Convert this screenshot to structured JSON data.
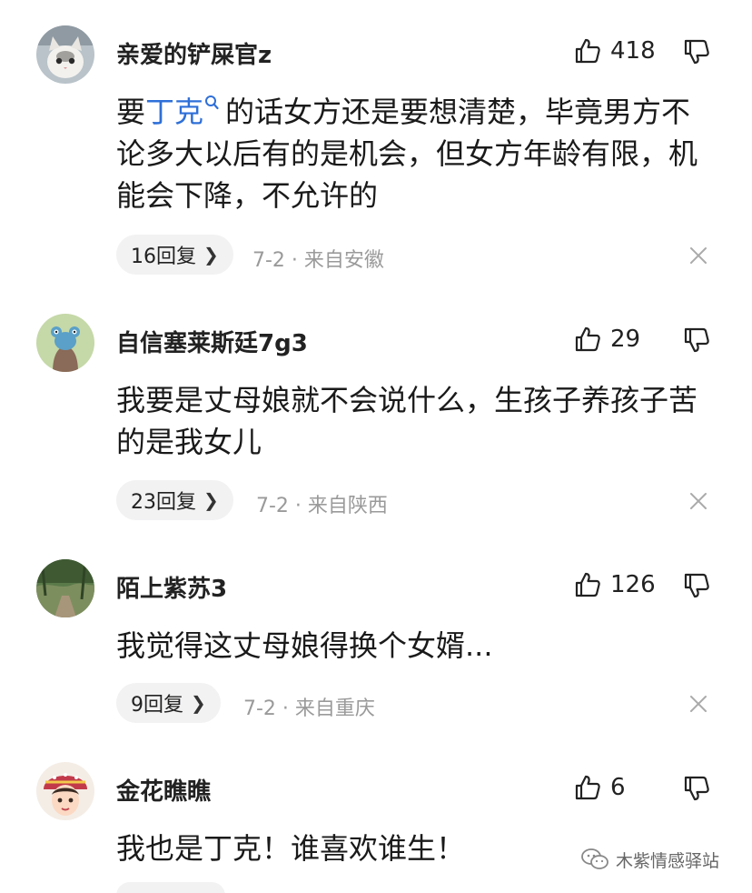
{
  "comments": [
    {
      "username": "亲爱的铲屎官z",
      "likes": "418",
      "text_before": "要",
      "keyword": "丁克",
      "text_after": "的话女方还是要想清楚，毕竟男方不论多大以后有的是机会，但女方年龄有限，机能会下降，不允许的",
      "reply_label": "16回复",
      "meta": "7-2 · 来自安徽"
    },
    {
      "username": "自信塞莱斯廷7g3",
      "likes": "29",
      "text": "我要是丈母娘就不会说什么，生孩子养孩子苦的是我女儿",
      "reply_label": "23回复",
      "meta": "7-2 · 来自陕西"
    },
    {
      "username": "陌上紫苏3",
      "likes": "126",
      "text": "我觉得这丈母娘得换个女婿...",
      "reply_label": "9回复",
      "meta": "7-2 · 来自重庆"
    },
    {
      "username": "金花瞧瞧",
      "likes": "6",
      "text": "我也是丁克！谁喜欢谁生！"
    }
  ],
  "icons": {
    "like": "thumbs-up-icon",
    "dislike": "thumbs-down-icon",
    "close": "close-icon",
    "reply_chevron": "chevron-right-icon",
    "keyword_search": "search-icon"
  },
  "colors": {
    "keyword": "#2e6fd8",
    "meta": "#9a9a9a",
    "pill_bg": "#f2f2f3"
  },
  "watermark": {
    "text": "木紫情感驿站"
  }
}
